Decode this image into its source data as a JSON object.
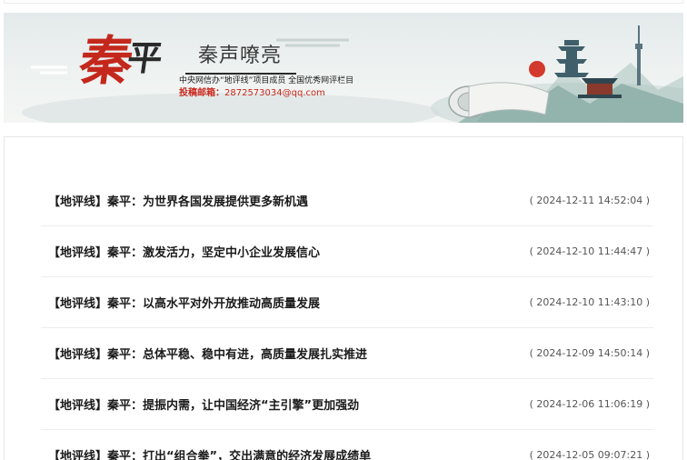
{
  "banner": {
    "brand_main": "秦",
    "brand_sub": "平",
    "slogan": "秦声嘹亮",
    "tagline": "中央网信办“地评线”项目成员 全国优秀网评栏目",
    "email_label": "投稿邮箱：",
    "email_value": "2872573034@qq.com"
  },
  "news": {
    "items": [
      {
        "title": "【地评线】秦平：为世界各国发展提供更多新机遇",
        "date": "( 2024-12-11 14:52:04 )"
      },
      {
        "title": "【地评线】秦平：激发活力，坚定中小企业发展信心",
        "date": "( 2024-12-10 11:44:47 )"
      },
      {
        "title": "【地评线】秦平：以高水平对外开放推动高质量发展",
        "date": "( 2024-12-10 11:43:10 )"
      },
      {
        "title": "【地评线】秦平：总体平稳、稳中有进，高质量发展扎实推进",
        "date": "( 2024-12-09 14:50:14 )"
      },
      {
        "title": "【地评线】秦平：提振内需，让中国经济“主引擎”更加强劲",
        "date": "( 2024-12-06 11:06:19 )"
      },
      {
        "title": "【地评线】秦平：打出“组合拳”，交出满意的经济发展成绩单",
        "date": "( 2024-12-05 09:07:21 )"
      }
    ]
  }
}
